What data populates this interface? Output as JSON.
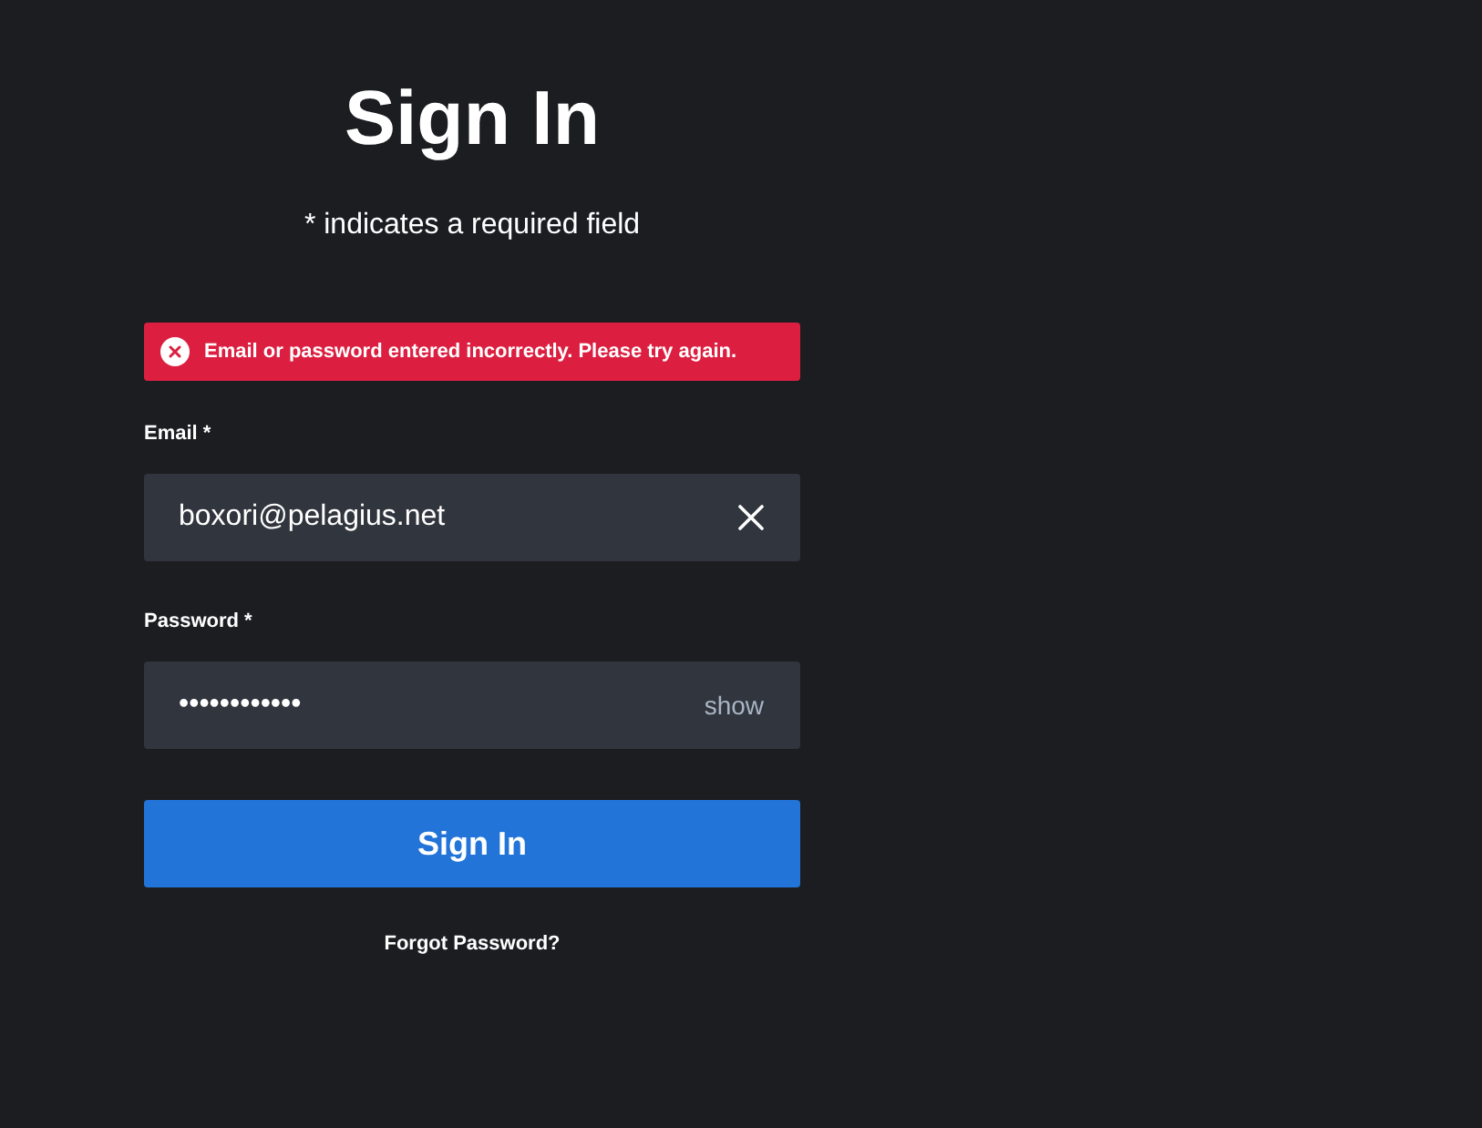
{
  "title": "Sign In",
  "subtitle": "* indicates a required field",
  "alert": {
    "kind": "error",
    "message": "Email or password entered incorrectly. Please try again."
  },
  "fields": [
    {
      "kind": "email",
      "label": "Email *",
      "value": "boxori@pelagius.net"
    },
    {
      "kind": "password",
      "label": "Password *",
      "value": "••••••••••••",
      "toggle": "show"
    }
  ],
  "submit": "Sign In",
  "link": "Forgot Password?"
}
